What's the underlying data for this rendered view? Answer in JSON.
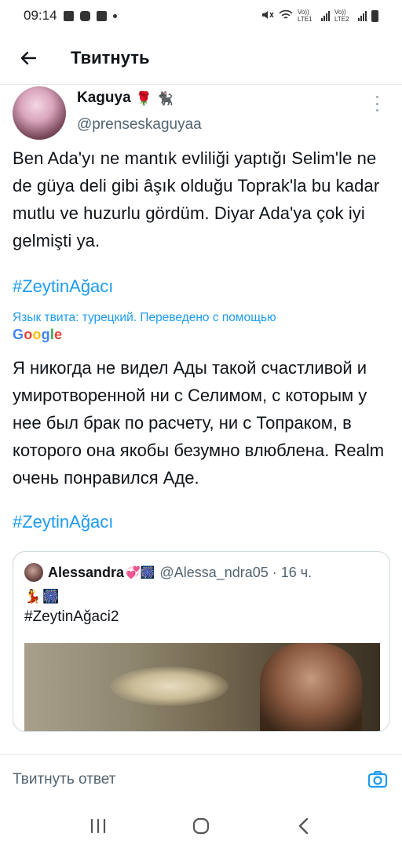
{
  "status_bar": {
    "time": "09:14",
    "network_1": "Vo)) LTE1",
    "network_2": "Vo)) LTE2"
  },
  "header": {
    "title": "Твитнуть",
    "back_icon": "arrow-left-icon"
  },
  "tweet": {
    "author_name": "Kaguya",
    "author_emojis": [
      "🌹",
      "🐈‍⬛"
    ],
    "author_handle": "@prenseskaguyaa",
    "text": "Ben Ada'yı ne mantık evliliği yaptığı Selim'le ne de güya deli gibi âşık olduğu Toprak'la bu kadar mutlu ve huzurlu gördüm. Diyar Ada'ya çok iyi gelmişti ya.",
    "hashtag": "#ZeytinAğacı",
    "translation_note": "Язык твита: турецкий. Переведено с помощью",
    "translation_provider": "Google",
    "translated_text": "Я никогда не видел Ады такой счастливой и умиротворенной ни с Селимом, с которым у нее был брак по расчету, ни с Топраком, в которого она якобы безумно влюблена. Realm очень понравился Аде.",
    "translated_hashtag": "#ZeytinAğacı"
  },
  "quote": {
    "name": "Alessandra",
    "name_emojis": "💞🎆",
    "handle": "@Alessa_ndra05",
    "separator": "·",
    "time": "16 ч.",
    "line2_emojis": [
      "💃",
      "🎆"
    ],
    "hashtag": "#ZeytinAğaci2"
  },
  "reply_bar": {
    "placeholder": "Твитнуть ответ",
    "camera_icon": "camera-icon"
  },
  "nav": {
    "recent_icon": "recent-apps-icon",
    "home_icon": "home-icon",
    "back_icon": "back-chevron-icon"
  },
  "colors": {
    "accent": "#1d9bf0",
    "text": "#0f1419",
    "secondary_text": "#536471",
    "divider": "#e7e7e7"
  }
}
